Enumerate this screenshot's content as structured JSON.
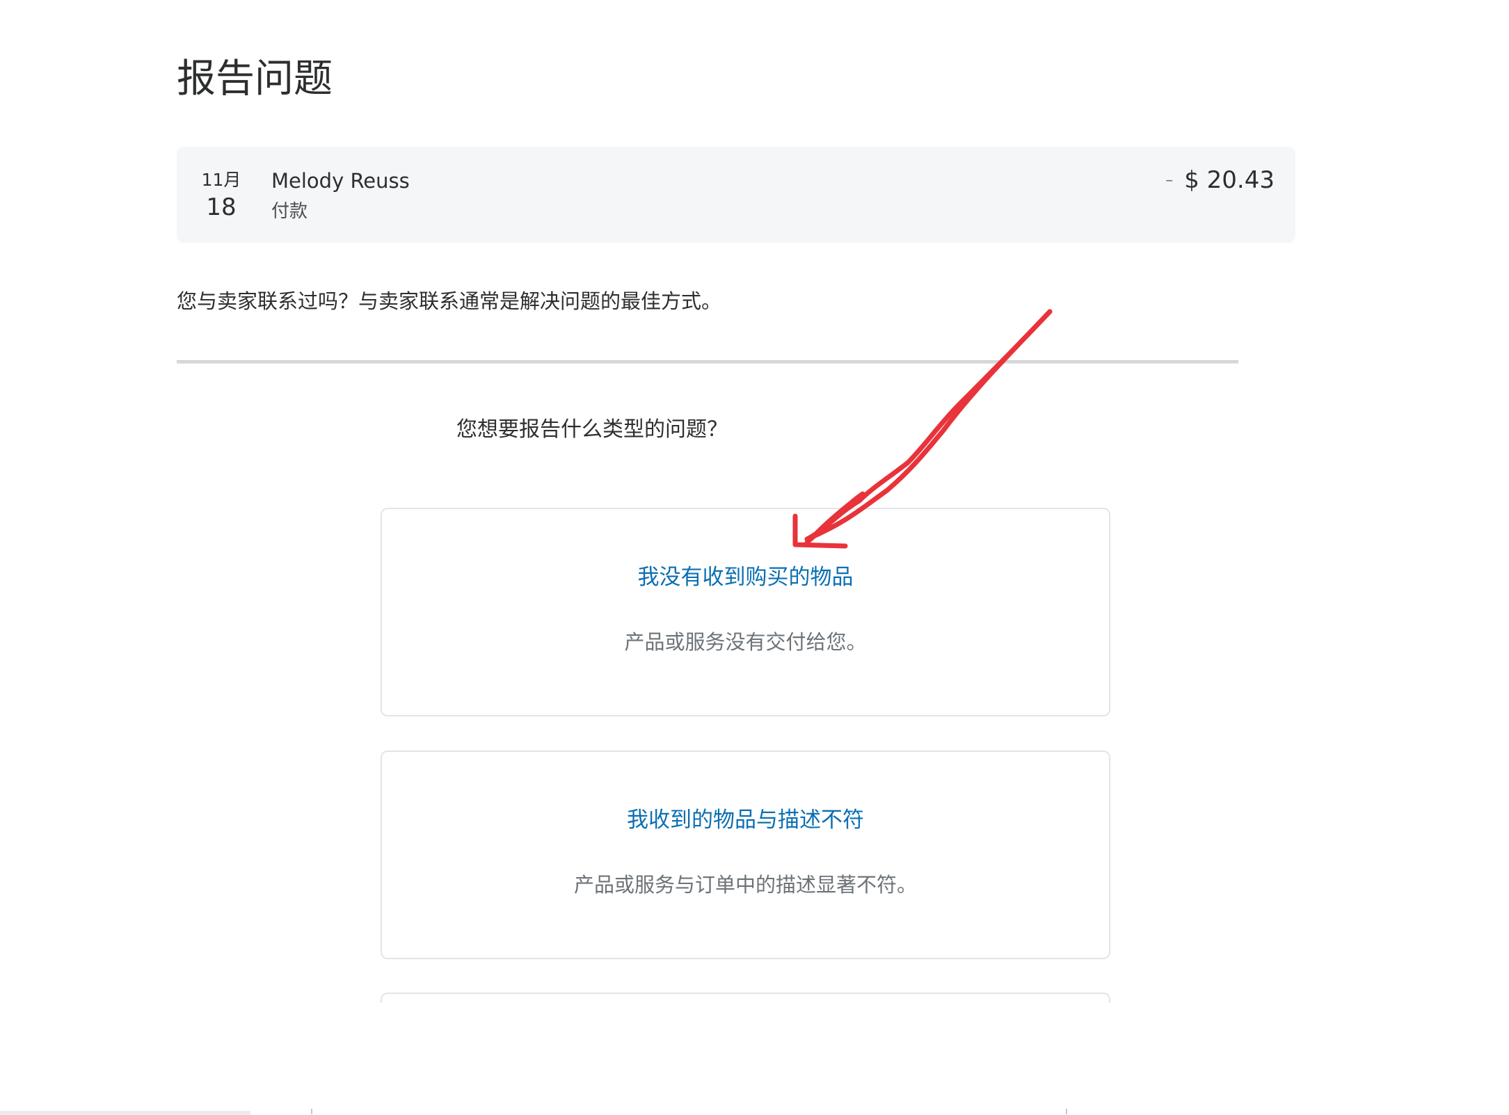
{
  "page": {
    "title": "报告问题"
  },
  "transaction": {
    "month": "11月",
    "day": "18",
    "merchant": "Melody Reuss",
    "type": "付款",
    "sign": "–",
    "amount": "$ 20.43"
  },
  "contact_note": "您与卖家联系过吗？与卖家联系通常是解决问题的最佳方式。",
  "question": "您想要报告什么类型的问题？",
  "options": [
    {
      "title": "我没有收到购买的物品",
      "description": "产品或服务没有交付给您。"
    },
    {
      "title": "我收到的物品与描述不符",
      "description": "产品或服务与订单中的描述显著不符。"
    }
  ],
  "colors": {
    "link_blue": "#0b6fb3",
    "card_bg": "#f4f6f8",
    "annotation_red": "#e8333b"
  },
  "icons": {
    "annotation": "red-hand-drawn-arrow-icon"
  }
}
